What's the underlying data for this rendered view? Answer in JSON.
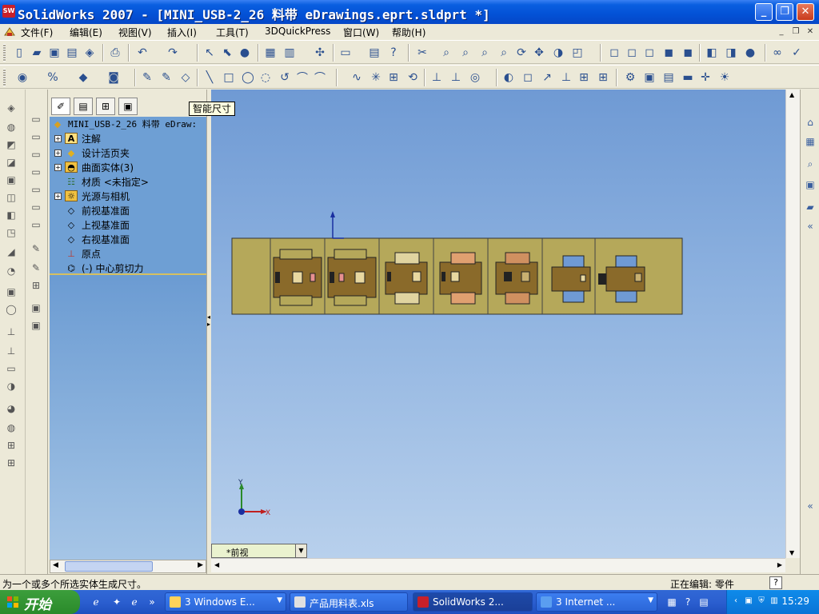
{
  "window": {
    "title": "SolidWorks 2007 - [MINI_USB-2_26 料带 eDrawings.eprt.sldprt *]",
    "app_icon_text": "SW",
    "min_label": "_",
    "max_label": "❐",
    "close_label": "✕"
  },
  "menu": {
    "items": [
      "文件(F)",
      "编辑(E)",
      "视图(V)",
      "插入(I)",
      "工具(T)",
      "3DQuickPress",
      "窗口(W)",
      "帮助(H)"
    ],
    "mdi_min": "_",
    "mdi_restore": "❐",
    "mdi_close": "✕"
  },
  "tooltip": "智能尺寸",
  "feature_tree": {
    "root": "MINI_USB-2_26 料带 eDraw:",
    "items": [
      {
        "label": "注解",
        "icon": "annotation-icon",
        "expandable": true
      },
      {
        "label": "设计活页夹",
        "icon": "design-binder-icon",
        "expandable": true
      },
      {
        "label": "曲面实体(3)",
        "icon": "surface-bodies-icon",
        "expandable": true
      },
      {
        "label": "材质 <未指定>",
        "icon": "material-icon",
        "expandable": false
      },
      {
        "label": "光源与相机",
        "icon": "lights-icon",
        "expandable": true
      },
      {
        "label": "前视基准面",
        "icon": "plane-icon",
        "expandable": false
      },
      {
        "label": "上视基准面",
        "icon": "plane-icon",
        "expandable": false
      },
      {
        "label": "右视基准面",
        "icon": "plane-icon",
        "expandable": false
      },
      {
        "label": "原点",
        "icon": "origin-icon",
        "expandable": false
      },
      {
        "label": "(-) 中心剪切力",
        "icon": "feature-icon",
        "expandable": false
      }
    ]
  },
  "viewport": {
    "view_name": "*前视",
    "axis_x": "X",
    "axis_y": "Y",
    "strip_color": "#b5a85a",
    "part_color": "#8a6a2a"
  },
  "status": {
    "message": "为一个或多个所选实体生成尺寸。",
    "editing": "正在编辑: 零件",
    "help": "?"
  },
  "taskbar": {
    "start_label": "开始",
    "tasks": [
      {
        "label": "3 Windows E...",
        "dropdown": true,
        "active": false
      },
      {
        "label": "产品用料表.xls",
        "dropdown": false,
        "active": false
      },
      {
        "label": "SolidWorks 2...",
        "dropdown": false,
        "active": true
      },
      {
        "label": "3 Internet ...",
        "dropdown": true,
        "active": false
      }
    ],
    "clock": "15:29"
  }
}
